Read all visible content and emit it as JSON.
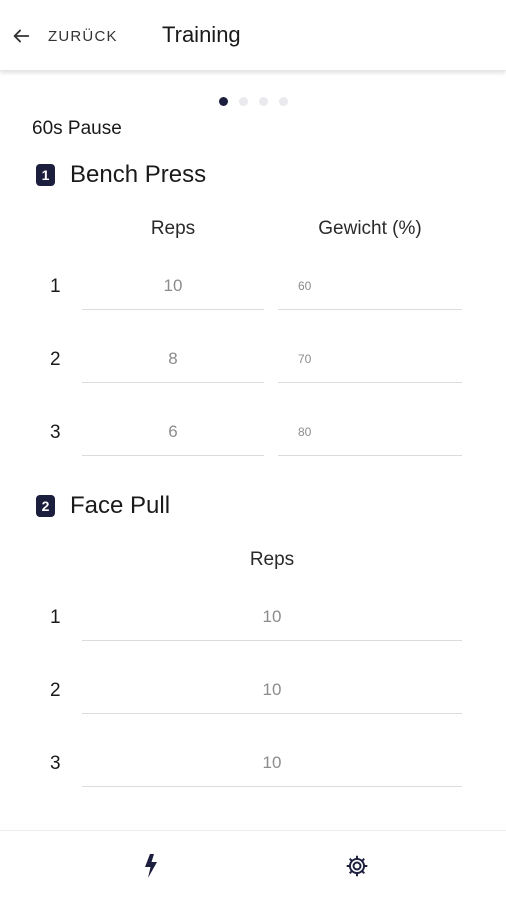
{
  "header": {
    "back_label": "ZURÜCK",
    "title": "Training"
  },
  "pager": {
    "total": 4,
    "active_index": 0
  },
  "pause_label": "60s Pause",
  "exercises": [
    {
      "number": "1",
      "name": "Bench Press",
      "columns": [
        "Reps",
        "Gewicht (%)"
      ],
      "sets": [
        {
          "set": "1",
          "reps": "10",
          "weight": "60"
        },
        {
          "set": "2",
          "reps": "8",
          "weight": "70"
        },
        {
          "set": "3",
          "reps": "6",
          "weight": "80"
        }
      ]
    },
    {
      "number": "2",
      "name": "Face Pull",
      "columns": [
        "Reps"
      ],
      "sets": [
        {
          "set": "1",
          "reps": "10"
        },
        {
          "set": "2",
          "reps": "10"
        },
        {
          "set": "3",
          "reps": "10"
        }
      ]
    }
  ],
  "bottom_nav": {
    "items": [
      {
        "icon": "lightning-icon"
      },
      {
        "icon": "gear-icon"
      }
    ]
  },
  "colors": {
    "accent": "#1b1e3d",
    "value_text": "#8c8c8c",
    "divider": "#dcdcdc"
  }
}
